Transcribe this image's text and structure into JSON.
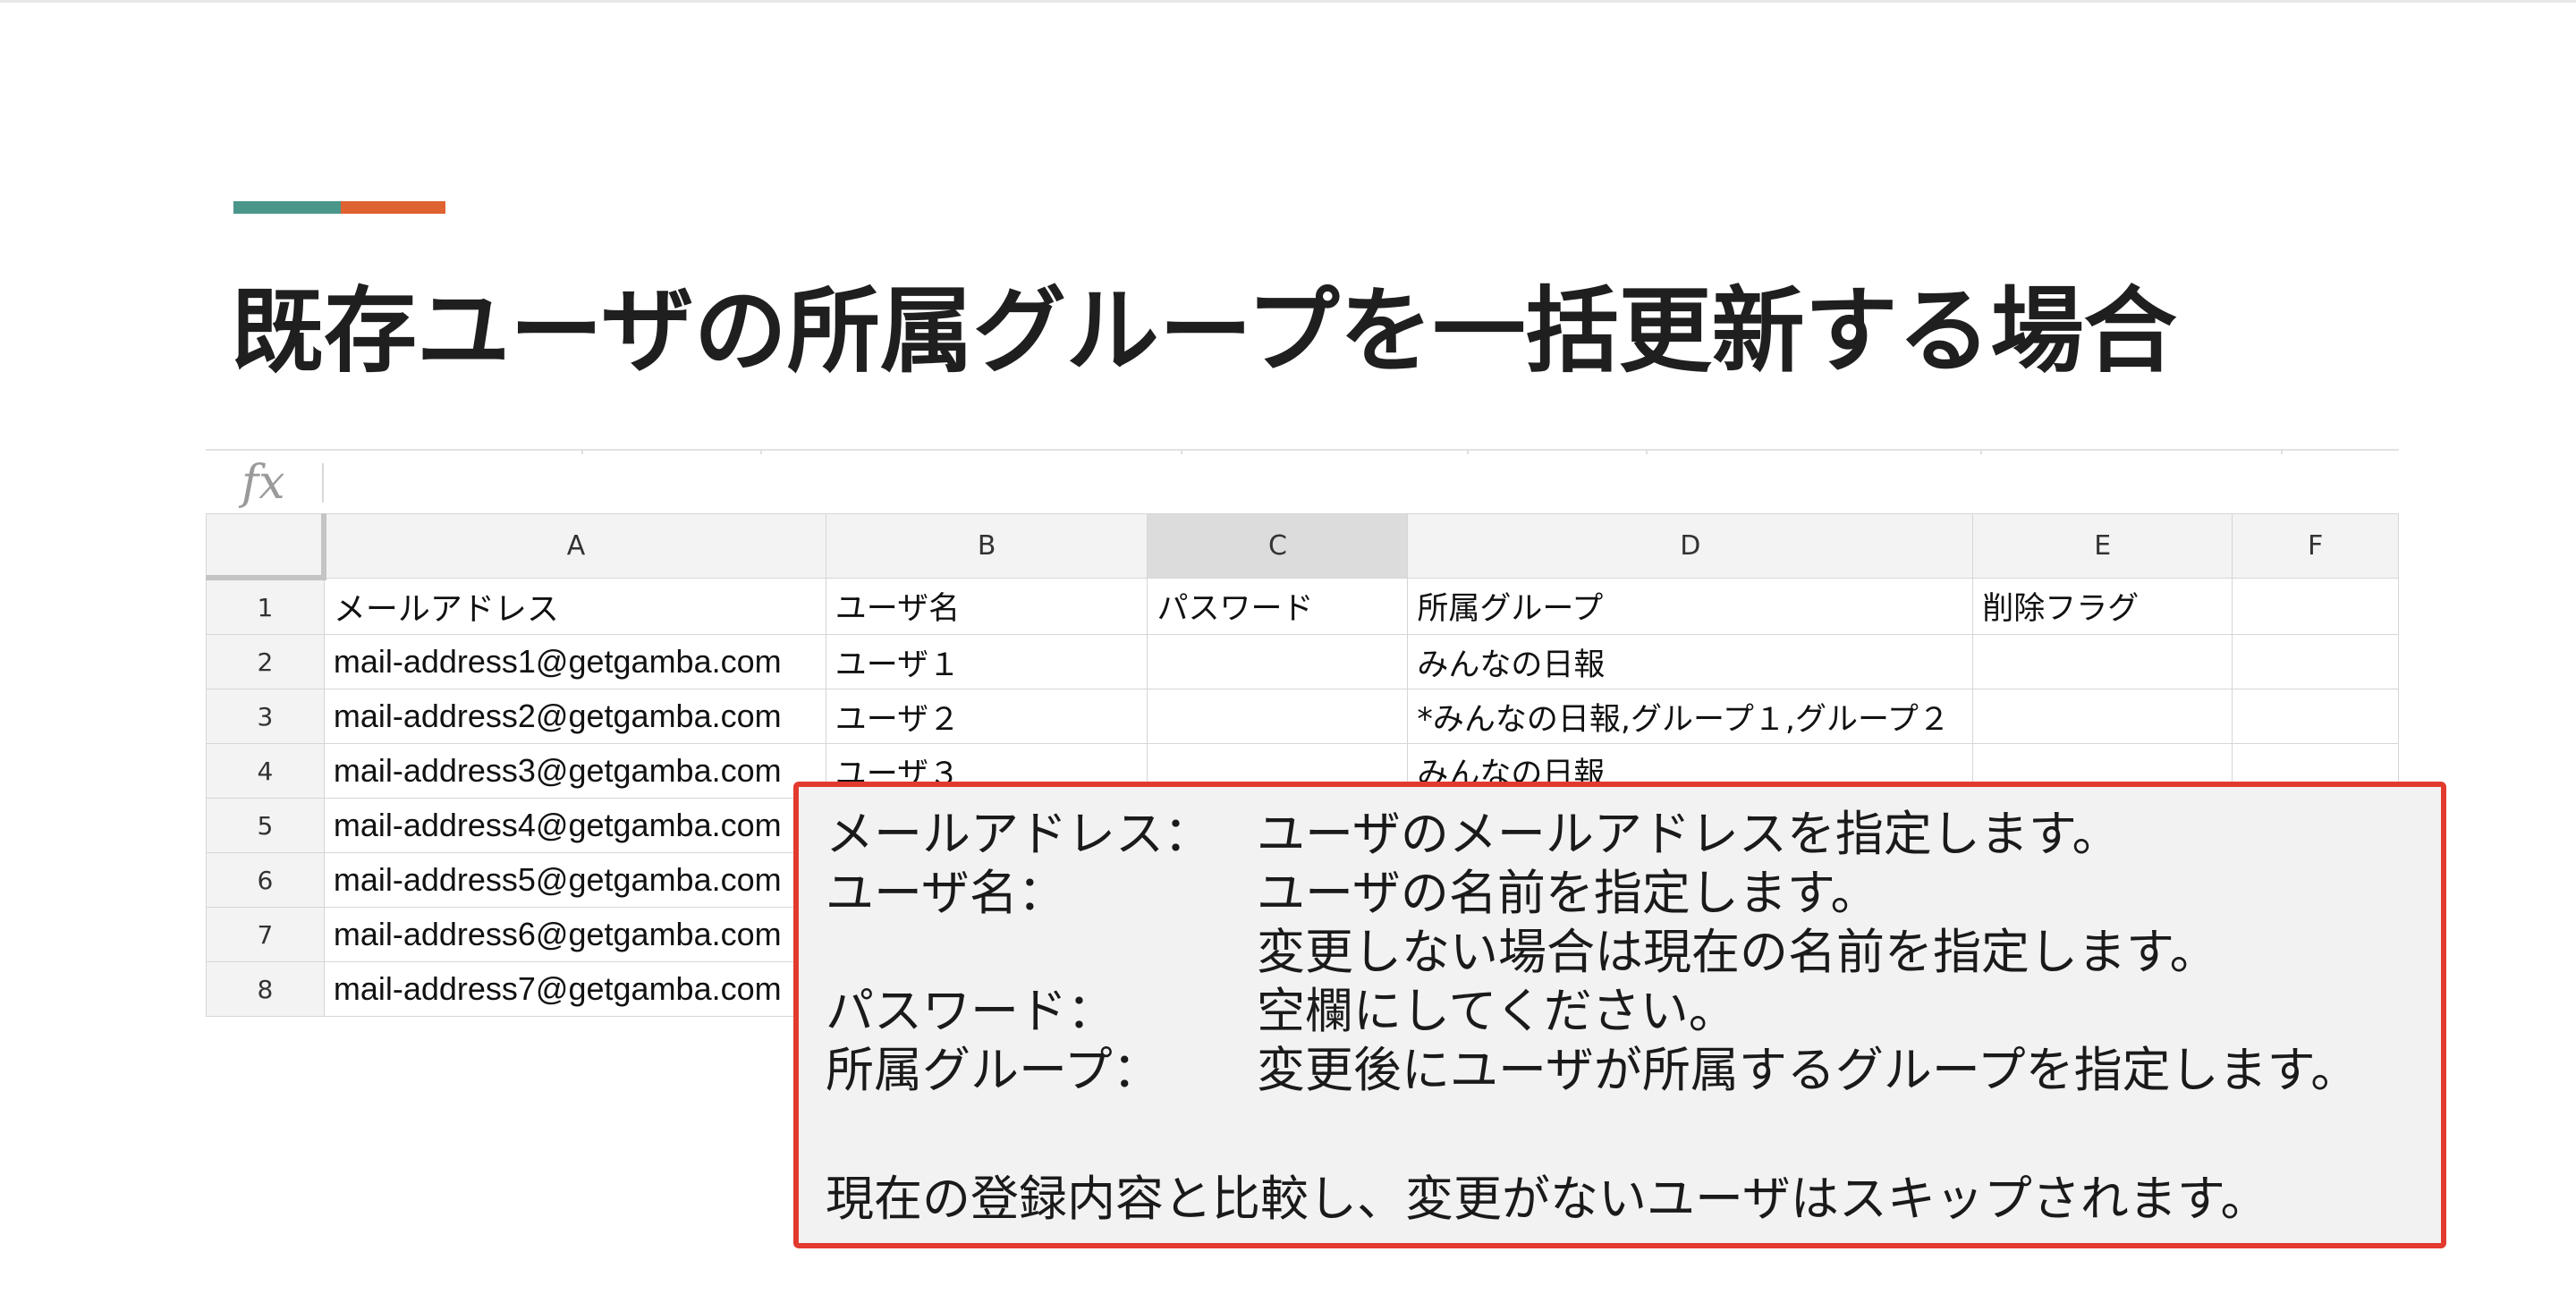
{
  "slide": {
    "title": "既存ユーザの所属グループを一括更新する場合",
    "accent_colors": [
      "#4a968a",
      "#df6231"
    ]
  },
  "spreadsheet": {
    "formula_bar": {
      "icon": "fx",
      "value": ""
    },
    "column_headers": [
      "A",
      "B",
      "C",
      "D",
      "E",
      "F"
    ],
    "selected_column": "C",
    "rows": [
      {
        "num": "1",
        "cells": [
          "メールアドレス",
          "ユーザ名",
          "パスワード",
          "所属グループ",
          "削除フラグ",
          ""
        ]
      },
      {
        "num": "2",
        "cells": [
          "mail-address1@getgamba.com",
          "ユーザ１",
          "",
          "みんなの日報",
          "",
          ""
        ]
      },
      {
        "num": "3",
        "cells": [
          "mail-address2@getgamba.com",
          "ユーザ２",
          "",
          "*みんなの日報,グループ１,グループ２",
          "",
          ""
        ]
      },
      {
        "num": "4",
        "cells": [
          "mail-address3@getgamba.com",
          "ユーザ３",
          "",
          "みんなの日報",
          "",
          ""
        ]
      },
      {
        "num": "5",
        "cells": [
          "mail-address4@getgamba.com",
          "",
          "",
          "",
          "",
          ""
        ]
      },
      {
        "num": "6",
        "cells": [
          "mail-address5@getgamba.com",
          "",
          "",
          "",
          "",
          ""
        ]
      },
      {
        "num": "7",
        "cells": [
          "mail-address6@getgamba.com",
          "",
          "",
          "",
          "",
          ""
        ]
      },
      {
        "num": "8",
        "cells": [
          "mail-address7@getgamba.com",
          "",
          "",
          "",
          "",
          ""
        ]
      }
    ]
  },
  "callout": {
    "border_color": "#e23a2e",
    "lines": [
      {
        "label": "メールアドレス：",
        "text": "ユーザのメールアドレスを指定します。"
      },
      {
        "label": "ユーザ名：",
        "text": "ユーザの名前を指定します。"
      },
      {
        "label": "",
        "text": "変更しない場合は現在の名前を指定します。"
      },
      {
        "label": "パスワード：",
        "text": "空欄にしてください。"
      },
      {
        "label": "所属グループ：",
        "text": "変更後にユーザが所属するグループを指定します。"
      }
    ],
    "note": "現在の登録内容と比較し、変更がないユーザはスキップされます。"
  }
}
